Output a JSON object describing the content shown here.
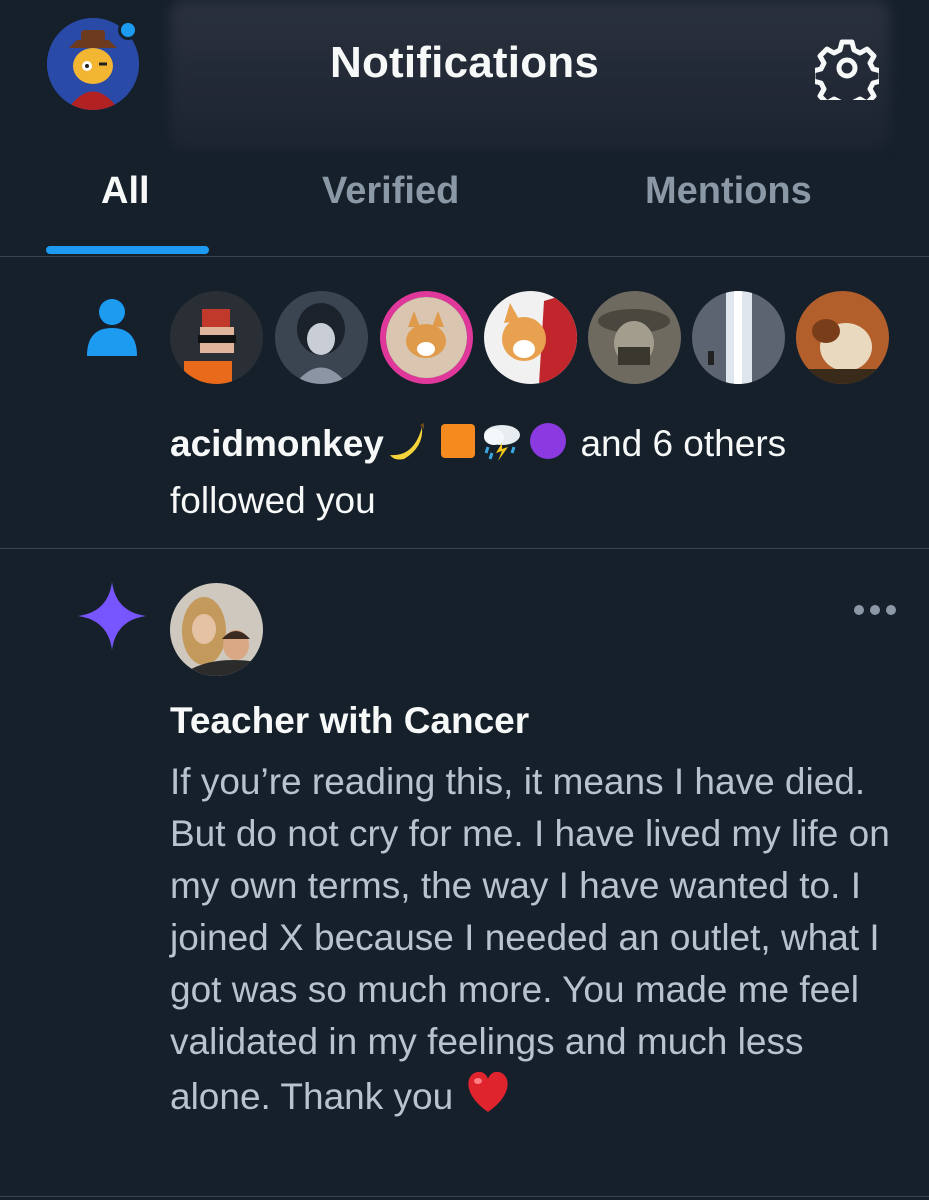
{
  "header": {
    "title": "Notifications",
    "icons": {
      "avatar": "profile-avatar",
      "settings": "gear-icon"
    }
  },
  "tabs": [
    {
      "label": "All",
      "active": true
    },
    {
      "label": "Verified",
      "active": false
    },
    {
      "label": "Mentions",
      "active": false
    }
  ],
  "follow_notification": {
    "icon": "person-icon",
    "name": "acidmonkey",
    "name_emojis": [
      "banana",
      "orange-square",
      "cloud-with-lightning-and-rain",
      "purple-circle"
    ],
    "others": "and 6 others",
    "action": "followed you",
    "follower_count_avatars": 7
  },
  "post_notification": {
    "icon": "sparkle-icon",
    "author": "Teacher with Cancer",
    "body": "If you’re reading this, it means I have died. But do not cry for me. I have lived my life on my own terms, the way I have wanted to. I joined X because I needed an outlet, what I got was so much more. You made me feel validated in my feelings and much less alone. Thank you",
    "body_emoji": "red-heart",
    "more_icon": "more-dots-icon"
  },
  "colors": {
    "background": "#15202b",
    "accent": "#1d9bf0",
    "sparkle": "#7856ff",
    "divider": "#38444d",
    "muted_text": "#8b98a5"
  }
}
